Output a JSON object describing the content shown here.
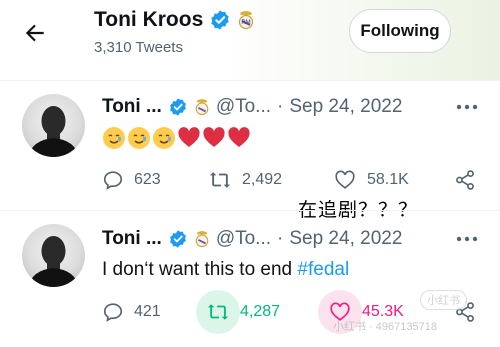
{
  "header": {
    "name": "Toni Kroos",
    "tweets_count": "3,310 Tweets",
    "follow_label": "Following"
  },
  "tweets": [
    {
      "author": "Toni ...",
      "handle": "@To...",
      "separator": "·",
      "date": "Sep 24, 2022",
      "emojis": [
        "smiling-face-with-tear",
        "smiling-face-with-tear",
        "smiling-face-with-tear",
        "red-heart",
        "red-heart",
        "red-heart"
      ],
      "replies": "623",
      "retweets": "2,492",
      "likes": "58.1K"
    },
    {
      "author": "Toni ...",
      "handle": "@To...",
      "separator": "·",
      "date": "Sep 24, 2022",
      "text": "I don‘t want this to end ",
      "hashtag": "#fedal",
      "replies": "421",
      "retweets": "4,287",
      "likes": "45.3K",
      "retweeted": true,
      "liked": true
    }
  ],
  "overlay_caption": "在追剧？？？",
  "watermark": {
    "text": "小红书 · 4967135718",
    "logo": "小红书"
  },
  "colors": {
    "accent": "#1d9bf0",
    "retweet_green": "#00ba7c",
    "like_pink": "#f91880",
    "secondary_text": "#536471"
  }
}
